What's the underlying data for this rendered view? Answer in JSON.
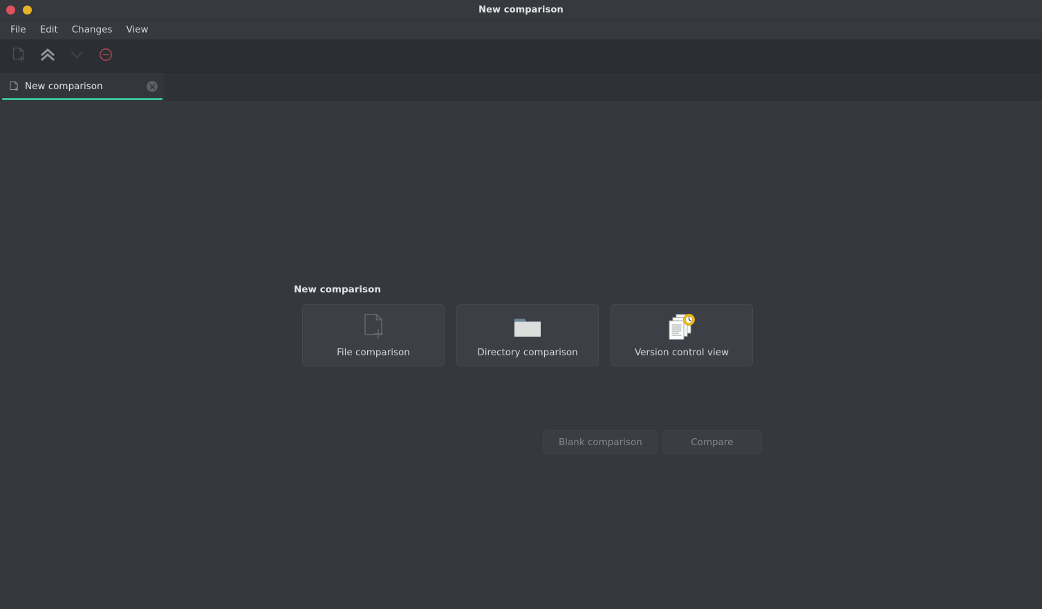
{
  "window": {
    "title": "New comparison",
    "controls": [
      {
        "name": "close",
        "color": "#e2515e"
      },
      {
        "name": "minimize",
        "color": "#e8b424"
      }
    ]
  },
  "menubar": {
    "items": [
      {
        "label": "File"
      },
      {
        "label": "Edit"
      },
      {
        "label": "Changes"
      },
      {
        "label": "View"
      }
    ]
  },
  "toolbar": {
    "buttons": [
      {
        "name": "new-comparison",
        "icon": "document-new-icon",
        "tooltip": "New comparison",
        "disabled": true
      },
      {
        "name": "previous-change",
        "icon": "chevron-double-up-icon",
        "tooltip": "Previous change",
        "disabled": false
      },
      {
        "name": "next-change",
        "icon": "chevron-down-icon",
        "tooltip": "Next change",
        "disabled": true
      },
      {
        "name": "stop",
        "icon": "stop-circle-icon",
        "tooltip": "Stop",
        "disabled": false
      }
    ]
  },
  "tabs": [
    {
      "label": "New comparison",
      "icon": "document-new-icon",
      "close_label": "✕",
      "active": true
    }
  ],
  "main": {
    "section_title": "New comparison",
    "cards": [
      {
        "label": "File comparison",
        "icon": "document-new-icon"
      },
      {
        "label": "Directory comparison",
        "icon": "folder-icon"
      },
      {
        "label": "Version control view",
        "icon": "version-control-icon"
      }
    ],
    "actions": [
      {
        "label": "Blank comparison",
        "disabled": true
      },
      {
        "label": "Compare",
        "disabled": true
      }
    ]
  },
  "colors": {
    "accent": "#3fc0a0",
    "window_bg": "#35383d",
    "toolbar_bg": "#2b2e33",
    "tabbar_bg": "#2e3136",
    "card_bg": "#3c3f45",
    "text_primary": "#e3e5e7",
    "text_secondary": "#d4d6d9",
    "text_disabled": "#85898f",
    "stop_icon": "#9e4a4f",
    "folder_tab": "#6a8796",
    "folder_body": "#dcdedd",
    "clock_badge": "#f2c318"
  }
}
